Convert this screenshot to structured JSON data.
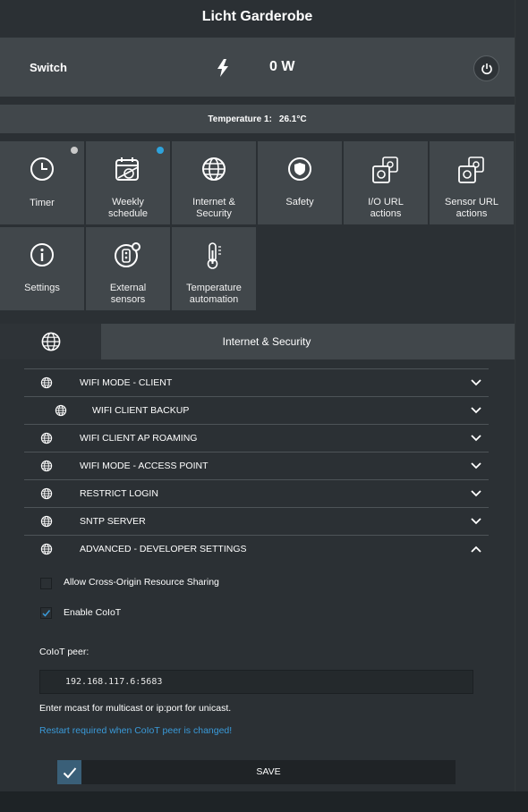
{
  "title": "Licht Garderobe",
  "switch": {
    "label": "Switch",
    "power": "0 W"
  },
  "temperature": {
    "label": "Temperature 1:",
    "value": "26.1°C"
  },
  "tiles": [
    {
      "label1": "Timer",
      "label2": "",
      "icon": "clock-icon",
      "dot": "#c9c9c9"
    },
    {
      "label1": "Weekly",
      "label2": "schedule",
      "icon": "weekly-schedule-icon",
      "dot": "#2ea3dc"
    },
    {
      "label1": "Internet &",
      "label2": "Security",
      "icon": "globe-icon"
    },
    {
      "label1": "Safety",
      "label2": "",
      "icon": "shield-icon"
    },
    {
      "label1": "I/O URL",
      "label2": "actions",
      "icon": "io-url-icon"
    },
    {
      "label1": "Sensor URL",
      "label2": "actions",
      "icon": "sensor-url-icon"
    },
    {
      "label1": "Settings",
      "label2": "",
      "icon": "info-icon"
    },
    {
      "label1": "External",
      "label2": "sensors",
      "icon": "external-sensor-icon"
    },
    {
      "label1": "Temperature",
      "label2": "automation",
      "icon": "thermometer-icon"
    }
  ],
  "section": {
    "title": "Internet & Security"
  },
  "accordion": [
    {
      "label": "WIFI MODE - CLIENT",
      "expanded": false
    },
    {
      "label": "WIFI CLIENT BACKUP",
      "expanded": false
    },
    {
      "label": "WIFI CLIENT AP ROAMING",
      "expanded": false
    },
    {
      "label": "WIFI MODE - ACCESS POINT",
      "expanded": false
    },
    {
      "label": "RESTRICT LOGIN",
      "expanded": false
    },
    {
      "label": "SNTP SERVER",
      "expanded": false
    },
    {
      "label": "ADVANCED - DEVELOPER SETTINGS",
      "expanded": true
    }
  ],
  "advanced": {
    "cors_label": "Allow Cross-Origin Resource Sharing",
    "cors_checked": false,
    "coiot_label": "Enable CoIoT",
    "coiot_checked": true,
    "peer_label": "CoIoT peer:",
    "peer_value": "192.168.117.6:5683",
    "hint": "Enter mcast for multicast or ip:port for unicast.",
    "warning": "Restart required when CoIoT peer is changed!",
    "save_label": "SAVE"
  },
  "colors": {
    "accent": "#2ea3dc",
    "panel": "#41474b",
    "background": "#2b3034"
  }
}
